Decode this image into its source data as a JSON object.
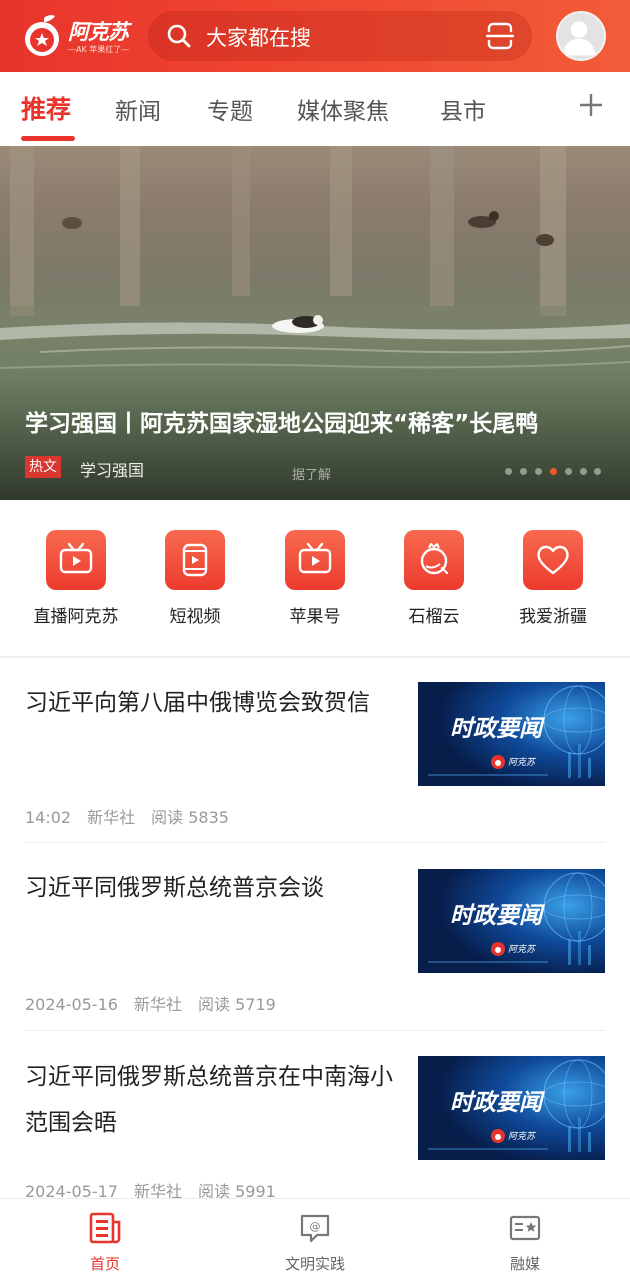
{
  "header": {
    "logo_text": "阿克苏",
    "logo_subtext": "—AK 苹果红了—",
    "search_placeholder": "大家都在搜",
    "icons": {
      "search": "search-icon",
      "scan": "scan-icon",
      "avatar": "user-avatar-icon"
    }
  },
  "tabs": [
    {
      "label": "推荐",
      "active": true
    },
    {
      "label": "新闻",
      "active": false
    },
    {
      "label": "专题",
      "active": false
    },
    {
      "label": "媒体聚焦",
      "active": false
    },
    {
      "label": "县市",
      "active": false
    }
  ],
  "banner": {
    "title": "学习强国丨阿克苏国家湿地公园迎来“稀客”长尾鸭",
    "tag": "热文",
    "source": "学习强国",
    "hint": "据了解",
    "slides_total": 7,
    "active_slide": 4
  },
  "quick_entries": [
    {
      "label": "直播阿克苏",
      "icon": "tv-icon"
    },
    {
      "label": "短视频",
      "icon": "video-play-icon"
    },
    {
      "label": "苹果号",
      "icon": "tv-icon"
    },
    {
      "label": "石榴云",
      "icon": "pomegranate-icon"
    },
    {
      "label": "我爱浙疆",
      "icon": "heart-icon"
    }
  ],
  "news": [
    {
      "title": "习近平向第八届中俄博览会致贺信",
      "time": "14:02",
      "source": "新华社",
      "reads": "阅读 5835",
      "thumb_text": "时政要闻",
      "thumb_logo": "阿克苏"
    },
    {
      "title": "习近平同俄罗斯总统普京会谈",
      "time": "2024-05-16",
      "source": "新华社",
      "reads": "阅读 5719",
      "thumb_text": "时政要闻",
      "thumb_logo": "阿克苏"
    },
    {
      "title": "习近平同俄罗斯总统普京在中南海小范围会晤",
      "time": "2024-05-17",
      "source": "新华社",
      "reads": "阅读 5991",
      "thumb_text": "时政要闻",
      "thumb_logo": "阿克苏"
    }
  ],
  "bottom_nav": [
    {
      "label": "首页",
      "icon": "news-home-icon",
      "active": true
    },
    {
      "label": "文明实践",
      "icon": "chat-at-icon",
      "active": false
    },
    {
      "label": "融媒",
      "icon": "media-card-icon",
      "active": false
    }
  ],
  "colors": {
    "brand_red": "#e8342c",
    "accent_orange": "#f05a2a",
    "text_dark": "#222222",
    "text_muted": "#999999"
  }
}
